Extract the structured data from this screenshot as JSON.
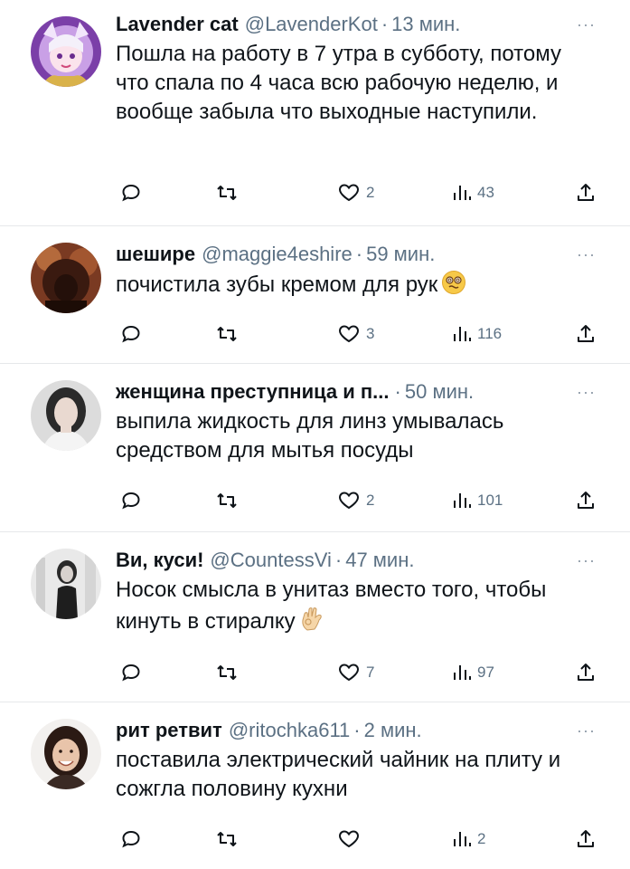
{
  "tweets": [
    {
      "name": "Lavender cat",
      "handle": "@LavenderKot",
      "sep": "·",
      "time": "13 мин.",
      "text": "Пошла на работу в 7 утра в субботу, потому что спала по 4 часа всю рабочую неделю, и вообще забыла что выходные наступили.",
      "likes": "2",
      "views": "43",
      "avatar": "anime-girl-avatar"
    },
    {
      "name": "шешире",
      "handle": "@maggie4eshire",
      "sep": "·",
      "time": "59 мин.",
      "text": "почистила зубы кремом для рук",
      "emoji": "dizzy-face-emoji",
      "likes": "3",
      "views": "116",
      "avatar": "dark-portrait-avatar"
    },
    {
      "name": "женщина преступница и п...",
      "handle": "",
      "sep": "·",
      "time": "50 мин.",
      "text": "выпила жидкость для линз умывалась средством для мытья посуды",
      "likes": "2",
      "views": "101",
      "avatar": "woman-portrait-avatar"
    },
    {
      "name": "Ви, куси!",
      "handle": "@CountessVi",
      "sep": "·",
      "time": "47 мин.",
      "text": "Носок смысла в унитаз вместо того, чтобы кинуть в стиралку",
      "emoji": "ok-hand-emoji",
      "likes": "7",
      "views": "97",
      "avatar": "bw-photo-avatar"
    },
    {
      "name": "рит ретвит",
      "handle": "@ritochka611",
      "sep": "·",
      "time": "2 мин.",
      "text": "поставила электрический чайник на плиту и сожгла половину кухни",
      "likes": "",
      "views": "2",
      "avatar": "smiling-woman-avatar"
    }
  ],
  "more_label": "···",
  "colors": {
    "text": "#0f1419",
    "secondary": "#5b7083",
    "divider": "#e6e8ea"
  }
}
